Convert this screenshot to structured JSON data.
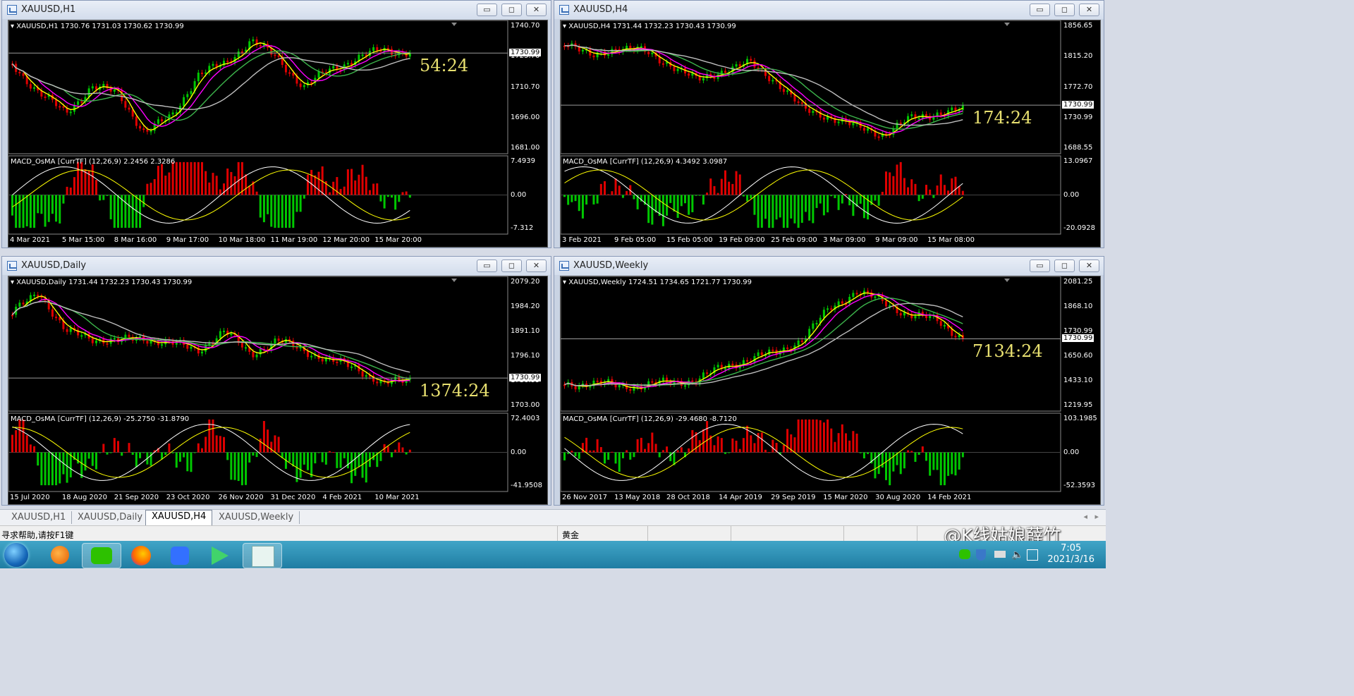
{
  "windows": [
    {
      "title": "XAUUSD,H1",
      "info": "XAUUSD,H1  1730.76 1731.03 1730.62 1730.99",
      "timer": "54:24",
      "prices": [
        "1740.70",
        "1725.70",
        "1710.70",
        "1696.00",
        "1681.00"
      ],
      "current": "1730.99",
      "macd_label": "MACD_OsMA [CurrTF] (12,26,9) 2.2456 2.3286",
      "macd_levels": [
        "7.4939",
        "0.00",
        "-7.312"
      ],
      "dates": [
        "4 Mar 2021",
        "5 Mar 15:00",
        "8 Mar 16:00",
        "9 Mar 17:00",
        "10 Mar 18:00",
        "11 Mar 19:00",
        "12 Mar 20:00",
        "15 Mar 20:00"
      ]
    },
    {
      "title": "XAUUSD,H4",
      "info": "XAUUSD,H4  1731.44 1732.23 1730.43 1730.99",
      "timer": "174:24",
      "prices": [
        "1856.65",
        "1815.20",
        "1772.70",
        "1730.99",
        "1688.55"
      ],
      "current": "1730.99",
      "macd_label": "MACD_OsMA [CurrTF] (12,26,9) 4.3492 3.0987",
      "macd_levels": [
        "13.0967",
        "0.00",
        "-20.0928"
      ],
      "dates": [
        "3 Feb 2021",
        "9 Feb 05:00",
        "15 Feb 05:00",
        "19 Feb 09:00",
        "25 Feb 09:00",
        "3 Mar 09:00",
        "9 Mar 09:00",
        "15 Mar 08:00"
      ]
    },
    {
      "title": "XAUUSD,Daily",
      "info": "XAUUSD,Daily  1731.44 1732.23 1730.43 1730.99",
      "timer": "1374:24",
      "prices": [
        "2079.20",
        "1984.20",
        "1891.10",
        "1796.10",
        "1730.99",
        "1703.00"
      ],
      "current": "1730.99",
      "macd_label": "MACD_OsMA [CurrTF] (12,26,9) -25.2750 -31.8790",
      "macd_levels": [
        "72.4003",
        "0.00",
        "-41.9508"
      ],
      "dates": [
        "15 Jul 2020",
        "18 Aug 2020",
        "21 Sep 2020",
        "23 Oct 2020",
        "26 Nov 2020",
        "31 Dec 2020",
        "4 Feb 2021",
        "10 Mar 2021"
      ]
    },
    {
      "title": "XAUUSD,Weekly",
      "info": "XAUUSD,Weekly  1724.51 1734.65 1721.77 1730.99",
      "timer": "7134:24",
      "prices": [
        "2081.25",
        "1868.10",
        "1730.99",
        "1650.60",
        "1433.10",
        "1219.95"
      ],
      "current": "1730.99",
      "macd_label": "MACD_OsMA [CurrTF] (12,26,9) -29.4680 -8.7120",
      "macd_levels": [
        "103.1985",
        "0.00",
        "-52.3593"
      ],
      "dates": [
        "26 Nov 2017",
        "13 May 2018",
        "28 Oct 2018",
        "14 Apr 2019",
        "29 Sep 2019",
        "15 Mar 2020",
        "30 Aug 2020",
        "14 Feb 2021"
      ]
    }
  ],
  "window_buttons": {
    "minimize": "▭",
    "maximize": "◻",
    "close": "✕"
  },
  "tabs": [
    "XAUUSD,H1",
    "XAUUSD,Daily",
    "XAUUSD,H4",
    "XAUUSD,Weekly"
  ],
  "active_tab": 2,
  "status": {
    "help": "寻求帮助,请按F1键",
    "symbol": "黄金"
  },
  "watermark": "@K线姑娘薛竹",
  "clock": {
    "time": "7:05",
    "date": "2021/3/16"
  },
  "taskbar_apps": [
    "start-orb",
    "foxit-app",
    "wechat-app",
    "firefox-app",
    "feishu-app",
    "media-player-app",
    "qr-app"
  ],
  "colors": {
    "bull": "#00c800",
    "bear": "#e00000",
    "ma_yellow": "#ffff00",
    "ma_magenta": "#ff00ff",
    "ma_green": "#3cb44b",
    "ma_gray": "#bdbdbd",
    "timer": "#e8e070"
  }
}
